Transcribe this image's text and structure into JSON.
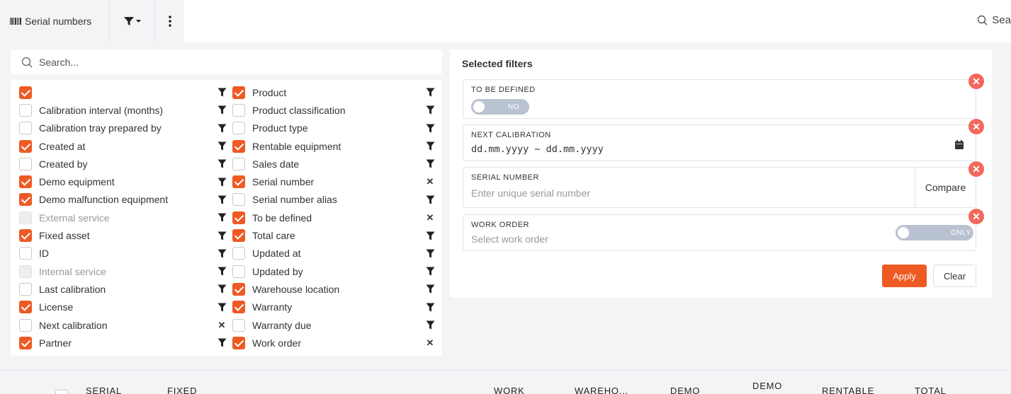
{
  "toolbar": {
    "tab_title": "Serial numbers",
    "search_label": "Sea"
  },
  "column_picker": {
    "search_placeholder": "Search...",
    "left": [
      {
        "label": "",
        "checked": true,
        "disabled": false,
        "action": "filter"
      },
      {
        "label": "Calibration interval (months)",
        "checked": false,
        "disabled": false,
        "action": "filter"
      },
      {
        "label": "Calibration tray prepared by",
        "checked": false,
        "disabled": false,
        "action": "filter"
      },
      {
        "label": "Created at",
        "checked": true,
        "disabled": false,
        "action": "filter"
      },
      {
        "label": "Created by",
        "checked": false,
        "disabled": false,
        "action": "filter"
      },
      {
        "label": "Demo equipment",
        "checked": true,
        "disabled": false,
        "action": "filter"
      },
      {
        "label": "Demo malfunction equipment",
        "checked": true,
        "disabled": false,
        "action": "filter"
      },
      {
        "label": "External service",
        "checked": false,
        "disabled": true,
        "action": "filter"
      },
      {
        "label": "Fixed asset",
        "checked": true,
        "disabled": false,
        "action": "filter"
      },
      {
        "label": "ID",
        "checked": false,
        "disabled": false,
        "action": "filter"
      },
      {
        "label": "Internal service",
        "checked": false,
        "disabled": true,
        "action": "filter"
      },
      {
        "label": "Last calibration",
        "checked": false,
        "disabled": false,
        "action": "filter"
      },
      {
        "label": "License",
        "checked": true,
        "disabled": false,
        "action": "filter"
      },
      {
        "label": "Next calibration",
        "checked": false,
        "disabled": false,
        "action": "remove"
      },
      {
        "label": "Partner",
        "checked": true,
        "disabled": false,
        "action": "filter"
      }
    ],
    "right": [
      {
        "label": "Product",
        "checked": true,
        "disabled": false,
        "action": "filter"
      },
      {
        "label": "Product classification",
        "checked": false,
        "disabled": false,
        "action": "filter"
      },
      {
        "label": "Product type",
        "checked": false,
        "disabled": false,
        "action": "filter"
      },
      {
        "label": "Rentable equipment",
        "checked": true,
        "disabled": false,
        "action": "filter"
      },
      {
        "label": "Sales date",
        "checked": false,
        "disabled": false,
        "action": "filter"
      },
      {
        "label": "Serial number",
        "checked": true,
        "disabled": false,
        "action": "remove"
      },
      {
        "label": "Serial number alias",
        "checked": false,
        "disabled": false,
        "action": "filter"
      },
      {
        "label": "To be defined",
        "checked": true,
        "disabled": false,
        "action": "remove"
      },
      {
        "label": "Total care",
        "checked": true,
        "disabled": false,
        "action": "filter"
      },
      {
        "label": "Updated at",
        "checked": false,
        "disabled": false,
        "action": "filter"
      },
      {
        "label": "Updated by",
        "checked": false,
        "disabled": false,
        "action": "filter"
      },
      {
        "label": "Warehouse location",
        "checked": true,
        "disabled": false,
        "action": "filter"
      },
      {
        "label": "Warranty",
        "checked": true,
        "disabled": false,
        "action": "filter"
      },
      {
        "label": "Warranty due",
        "checked": false,
        "disabled": false,
        "action": "filter"
      },
      {
        "label": "Work order",
        "checked": true,
        "disabled": false,
        "action": "remove"
      }
    ]
  },
  "selected_filters": {
    "title": "Selected filters",
    "to_be_defined": {
      "label": "TO BE DEFINED",
      "toggle_text": "NO",
      "toggle_on": false
    },
    "next_calibration": {
      "label": "NEXT CALIBRATION",
      "value": "dd.mm.yyyy ~ dd.mm.yyyy"
    },
    "serial_number": {
      "label": "SERIAL NUMBER",
      "placeholder": "Enter unique serial number",
      "compare_label": "Compare"
    },
    "work_order": {
      "label": "WORK ORDER",
      "placeholder": "Select work order",
      "toggle_text": "ONLY",
      "toggle_on": false
    },
    "apply_label": "Apply",
    "clear_label": "Clear"
  },
  "table_header": {
    "columns": [
      "SERIAL",
      "FIXED",
      "WORK",
      "WAREHO...",
      "DEMO",
      "DEMO",
      "RENTABLE",
      "TOTAL"
    ]
  },
  "colors": {
    "accent": "#ee5a24",
    "remove": "#f2685b",
    "toggle_off": "#b9c2d0"
  }
}
